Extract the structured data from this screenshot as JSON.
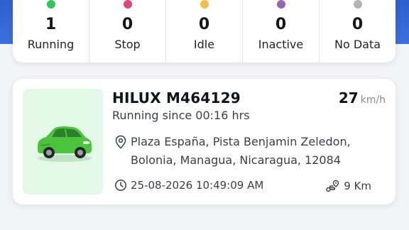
{
  "summary": {
    "stats": [
      {
        "count": "1",
        "label": "Running",
        "color": "#2fc65a"
      },
      {
        "count": "0",
        "label": "Stop",
        "color": "#e0457b"
      },
      {
        "count": "0",
        "label": "Idle",
        "color": "#f2bf4c"
      },
      {
        "count": "0",
        "label": "Inactive",
        "color": "#9567b3"
      },
      {
        "count": "0",
        "label": "No Data",
        "color": "#b3b3b7"
      }
    ]
  },
  "vehicle": {
    "name": "HILUX M464129",
    "speed_value": "27",
    "speed_unit": "km/h",
    "status": "Running since 00:16 hrs",
    "address_line1": "Plaza España, Pista Benjamin Zeledon,",
    "address_line2": "Bolonia, Managua, Nicaragua, 12084",
    "timestamp": "25-08-2026 10:49:09 AM",
    "distance": "9 Km",
    "car_color": "#4cc33f",
    "icons": {
      "car": "car-icon",
      "location": "location-pin-icon",
      "time": "clock-icon",
      "distance": "route-icon"
    }
  }
}
